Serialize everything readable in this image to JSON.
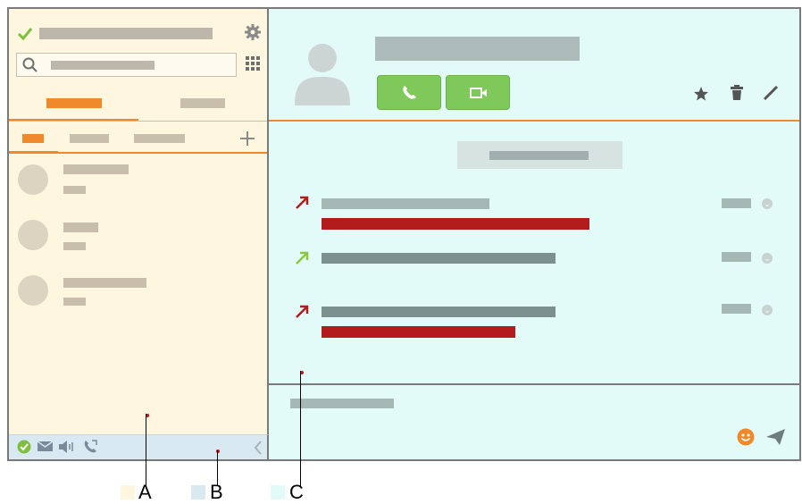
{
  "legend": [
    {
      "label": "A",
      "color": "#fff6e0"
    },
    {
      "label": "B",
      "color": "#d9e9f2"
    },
    {
      "label": "C",
      "color": "#e3fbf8"
    }
  ],
  "colors": {
    "accent": "#f0892c",
    "call_green": "#7fc95b",
    "outgoing_red": "#b31c1c",
    "incoming_green": "#8cc63f"
  },
  "icons": {
    "status": "check-icon",
    "settings": "gear-icon",
    "search": "search-icon",
    "dialpad": "dialpad-icon",
    "add": "plus-icon",
    "call": "phone-icon",
    "video": "video-icon",
    "favorite": "star-icon",
    "delete": "trash-icon",
    "edit": "pencil-icon",
    "emoji": "smiley-icon",
    "send": "send-icon",
    "collapse": "chevron-left-icon"
  }
}
